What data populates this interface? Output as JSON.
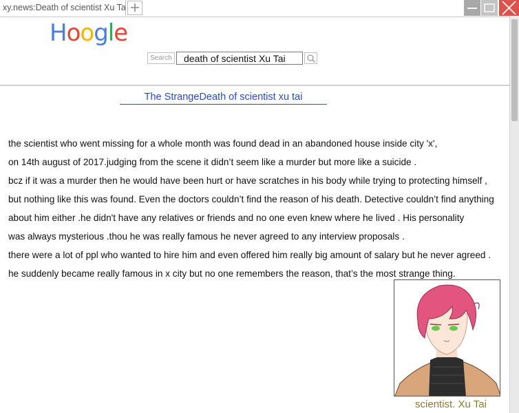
{
  "browser": {
    "tab_title": "xy.news:Death of scientist Xu Tai",
    "new_tab_icon": "plus-icon",
    "window_controls": [
      "minimize-icon",
      "maximize-icon",
      "close-icon"
    ]
  },
  "header": {
    "logo_letters": [
      {
        "char": "H",
        "color": "#4a7fe0"
      },
      {
        "char": "o",
        "color": "#e94235"
      },
      {
        "char": "o",
        "color": "#f5b400"
      },
      {
        "char": "g",
        "color": "#4a7fe0"
      },
      {
        "char": "l",
        "color": "#34a853"
      },
      {
        "char": "e",
        "color": "#e94235"
      }
    ],
    "search_label": "Search",
    "search_value": "death of scientist Xu Tai",
    "search_icon": "magnifier-icon"
  },
  "article": {
    "title": "The StrangeDeath of scientist xu tai",
    "lines": [
      "the scientist who went missing for a whole month was found dead in an abandoned house inside city 'x',",
      " on 14th august of 2017.judging from the scene it didn’t seem like a murder but more like a suicide .",
      "bcz if it was a murder then he would have been hurt or have scratches in his body while trying to protecting himself ,",
      "but nothing like this was found. Even the doctors couldn’t find the reason of his death. Detective couldn’t find anything",
      " about him either .he didn't have any relatives or friends and no one even knew where he lived . His personality",
      " was always mysterious .thou he was really famous he never agreed to any interview proposals .",
      "there were a lot of ppl who wanted to hire him and even offered him really big amount of salary but he never agreed .",
      "he suddenly became really famous in x city but no one remembers the reason, that’s the most strange thing."
    ],
    "portrait_caption": "scientist. Xu Tai"
  },
  "colors": {
    "link": "#2b49c7",
    "caption": "#8a7a35",
    "close_button": "#e0504a"
  }
}
